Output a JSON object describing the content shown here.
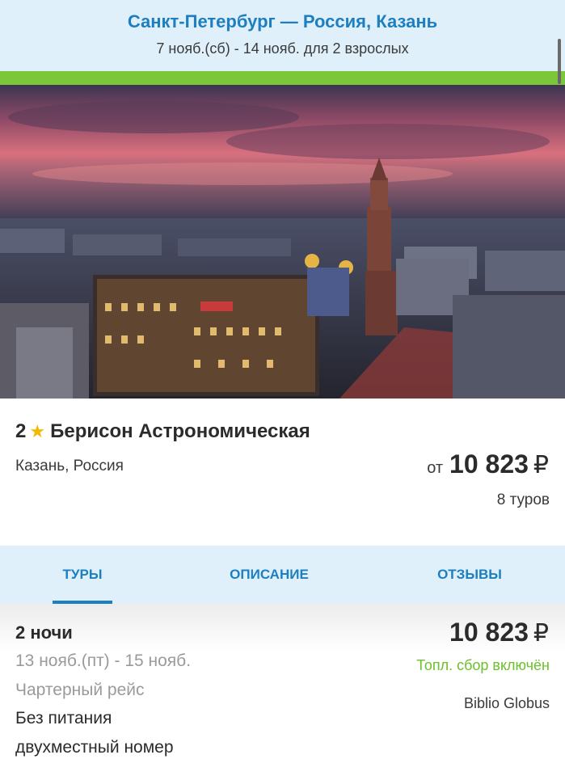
{
  "header": {
    "route": "Санкт-Петербург — Россия, Казань",
    "dates": "7 нояб.(сб) - 14 нояб. для 2 взрослых"
  },
  "hotel": {
    "stars": "2",
    "name": "Берисон Астрономическая",
    "location": "Казань, Россия",
    "price_prefix": "от",
    "price": "10 823",
    "currency": "₽",
    "tours_count": "8 туров"
  },
  "tabs": [
    {
      "label": "ТУРЫ",
      "active": true
    },
    {
      "label": "ОПИСАНИЕ",
      "active": false
    },
    {
      "label": "ОТЗЫВЫ",
      "active": false
    }
  ],
  "offer": {
    "nights": "2 ночи",
    "dates": "13 нояб.(пт) - 15 нояб.",
    "flight": "Чартерный рейс",
    "meal": "Без питания",
    "room": "двухместный номер",
    "price": "10 823",
    "currency": "₽",
    "fuel_note": "Топл. сбор включён",
    "operator": "Biblio Globus"
  },
  "colors": {
    "accent": "#1d7fc0",
    "header_bg": "#dff0fa",
    "green": "#7cc63a",
    "star": "#f5b800"
  },
  "icons": {
    "rating": "star-icon"
  }
}
